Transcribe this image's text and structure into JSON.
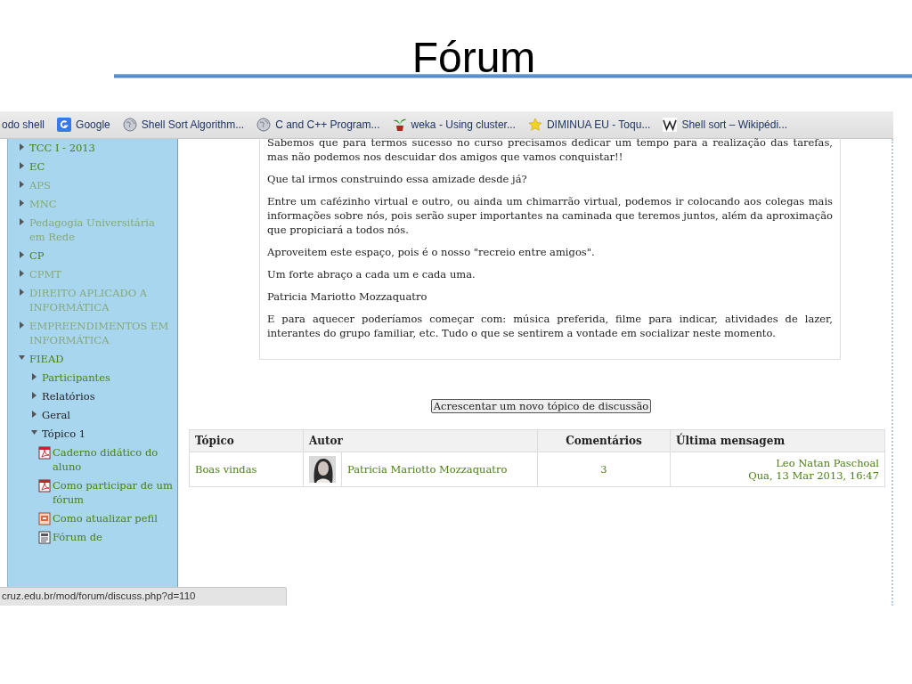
{
  "slide": {
    "title": "Fórum"
  },
  "bookmarks": [
    {
      "label": "odo shell",
      "kind": "none"
    },
    {
      "label": "Google",
      "kind": "google"
    },
    {
      "label": "Shell Sort Algorithm...",
      "kind": "globe"
    },
    {
      "label": "C and C++ Program...",
      "kind": "globe"
    },
    {
      "label": "weka - Using cluster...",
      "kind": "plant"
    },
    {
      "label": "DIMINUA EU - Toqu...",
      "kind": "star"
    },
    {
      "label": "Shell sort – Wikipédi...",
      "kind": "wiki"
    }
  ],
  "sidebar": {
    "items": [
      {
        "label": "TCC I - 2013",
        "kind": "node",
        "link": true,
        "dimmed": false,
        "expanded": false
      },
      {
        "label": "EC",
        "kind": "node",
        "link": true,
        "dimmed": false,
        "expanded": false
      },
      {
        "label": "APS",
        "kind": "node",
        "link": true,
        "dimmed": true,
        "expanded": false
      },
      {
        "label": "MNC",
        "kind": "node",
        "link": true,
        "dimmed": true,
        "expanded": false
      },
      {
        "label": "Pedagogia Universitária em Rede",
        "kind": "node",
        "link": true,
        "dimmed": true,
        "expanded": false
      },
      {
        "label": "CP",
        "kind": "node",
        "link": true,
        "dimmed": false,
        "expanded": false
      },
      {
        "label": "CPMT",
        "kind": "node",
        "link": true,
        "dimmed": true,
        "expanded": false
      },
      {
        "label": "DIREITO APLICADO A INFORMÁTICA",
        "kind": "node",
        "link": true,
        "dimmed": true,
        "expanded": false
      },
      {
        "label": "EMPREENDIMENTOS EM INFORMÁTICA",
        "kind": "node",
        "link": true,
        "dimmed": true,
        "expanded": false
      },
      {
        "label": "FIEAD",
        "kind": "node",
        "link": true,
        "dimmed": false,
        "expanded": true,
        "children": [
          {
            "label": "Participantes",
            "kind": "node",
            "link": true,
            "dimmed": false,
            "expanded": false
          },
          {
            "label": "Relatórios",
            "kind": "node",
            "link": false,
            "dimmed": false,
            "expanded": false
          },
          {
            "label": "Geral",
            "kind": "node",
            "link": false,
            "dimmed": false,
            "expanded": false
          },
          {
            "label": "Tópico 1",
            "kind": "node",
            "link": false,
            "dimmed": false,
            "expanded": true,
            "children": [
              {
                "label": "Caderno didático do aluno",
                "kind": "pdf",
                "link": true,
                "dimmed": false
              },
              {
                "label": "Como participar de um fórum",
                "kind": "pdf",
                "link": true,
                "dimmed": false
              },
              {
                "label": "Como atualizar pefil",
                "kind": "slides",
                "link": true,
                "dimmed": false
              },
              {
                "label": "Fórum de",
                "kind": "forum",
                "link": true,
                "dimmed": false
              }
            ]
          }
        ]
      }
    ]
  },
  "post": {
    "paragraphs": [
      "Sabemos que para termos sucesso no curso precisamos dedicar um tempo para a realização das tarefas, mas não podemos nos descuidar dos amigos que vamos conquistar!!",
      "Que tal irmos construindo essa amizade desde já?",
      "Entre um cafézinho virtual e outro, ou ainda um chimarrão virtual, podemos ir colocando aos colegas mais informações sobre nós, pois serão super importantes na caminada que teremos juntos, além da aproximação que propiciará a todos nós.",
      "Aproveitem este espaço, pois é o nosso \"recreio entre amigos\".",
      "Um forte abraço a cada um e cada uma.",
      "Patricia Mariotto Mozzaquatro",
      "E para aquecer poderíamos começar com: música preferida, filme para indicar, atividades de lazer, interantes do grupo familiar, etc. Tudo o que se sentirem a vontade em socializar neste momento."
    ]
  },
  "new_topic_button": "Acrescentar um novo tópico de discussão",
  "table": {
    "columns": [
      "Tópico",
      "Autor",
      "Comentários",
      "Última mensagem"
    ],
    "rows": [
      {
        "topic": "Boas vindas",
        "author": "Patricia Mariotto Mozzaquatro",
        "comments": "3",
        "last_post": {
          "author": "Leo Natan Paschoal",
          "date": "Qua, 13 Mar 2013, 16:47"
        }
      }
    ]
  },
  "status_bar": "cruz.edu.br/mod/forum/discuss.php?d=110"
}
